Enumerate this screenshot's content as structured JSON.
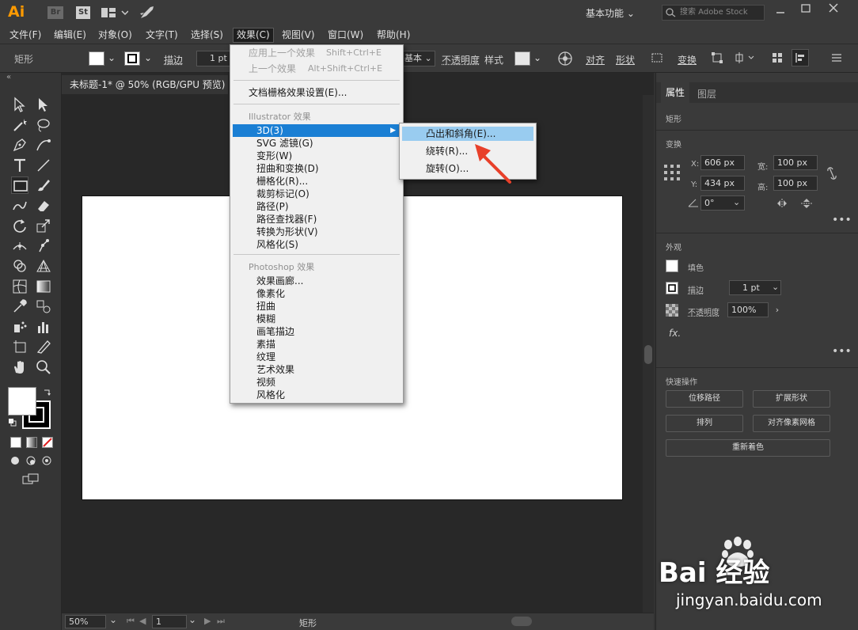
{
  "app": {
    "logo": "Ai",
    "br": "Br",
    "st": "St",
    "workspace": "基本功能",
    "search_placeholder": "搜索 Adobe Stock"
  },
  "menubar": [
    "文件(F)",
    "编辑(E)",
    "对象(O)",
    "文字(T)",
    "选择(S)",
    "效果(C)",
    "视图(V)",
    "窗口(W)",
    "帮助(H)"
  ],
  "control": {
    "object": "矩形",
    "stroke_label": "描边",
    "stroke_value": "1 pt",
    "style_value": "基本",
    "opacity_label": "不透明度",
    "style_label": "样式",
    "align": "对齐",
    "shape": "形状",
    "transform": "变换"
  },
  "document": {
    "tab": "未标题-1* @ 50% (RGB/GPU 预览)"
  },
  "effects_menu": {
    "top": [
      {
        "label": "应用上一个效果",
        "shortcut": "Shift+Ctrl+E"
      },
      {
        "label": "上一个效果",
        "shortcut": "Alt+Shift+Ctrl+E"
      }
    ],
    "raster_settings": "文档栅格效果设置(E)...",
    "illustrator_header": "Illustrator 效果",
    "illustrator_items": [
      "3D(3)",
      "SVG 滤镜(G)",
      "变形(W)",
      "扭曲和变换(D)",
      "栅格化(R)...",
      "裁剪标记(O)",
      "路径(P)",
      "路径查找器(F)",
      "转换为形状(V)",
      "风格化(S)"
    ],
    "photoshop_header": "Photoshop 效果",
    "photoshop_items": [
      "效果画廊...",
      "像素化",
      "扭曲",
      "模糊",
      "画笔描边",
      "素描",
      "纹理",
      "艺术效果",
      "视频",
      "风格化"
    ]
  },
  "submenu_3d": [
    "凸出和斜角(E)...",
    "绕转(R)...",
    "旋转(O)..."
  ],
  "properties": {
    "tab_properties": "属性",
    "tab_layers": "图层",
    "object_type": "矩形",
    "transform_header": "变换",
    "x_label": "X:",
    "x": "606 px",
    "y_label": "Y:",
    "y": "434 px",
    "w_label": "宽:",
    "w": "100 px",
    "h_label": "高:",
    "h": "100 px",
    "angle": "0°",
    "appearance_header": "外观",
    "fill": "填色",
    "stroke": "描边",
    "stroke_value": "1 pt",
    "opacity": "不透明度",
    "opacity_value": "100%",
    "fx": "fx.",
    "quick_header": "快速操作",
    "btn_offset": "位移路径",
    "btn_expand": "扩展形状",
    "btn_arrange": "排列",
    "btn_pixel": "对齐像素网格",
    "btn_recolor": "重新着色"
  },
  "status": {
    "zoom": "50%",
    "page": "1",
    "tool": "矩形"
  },
  "watermark": {
    "brand": "Bai 经验",
    "url": "jingyan.baidu.com"
  },
  "colors": {
    "highlight": "#1a7fd4",
    "submenu_highlight": "#99ccf0",
    "arrow": "#e8402a",
    "logo": "#ff9a00"
  }
}
